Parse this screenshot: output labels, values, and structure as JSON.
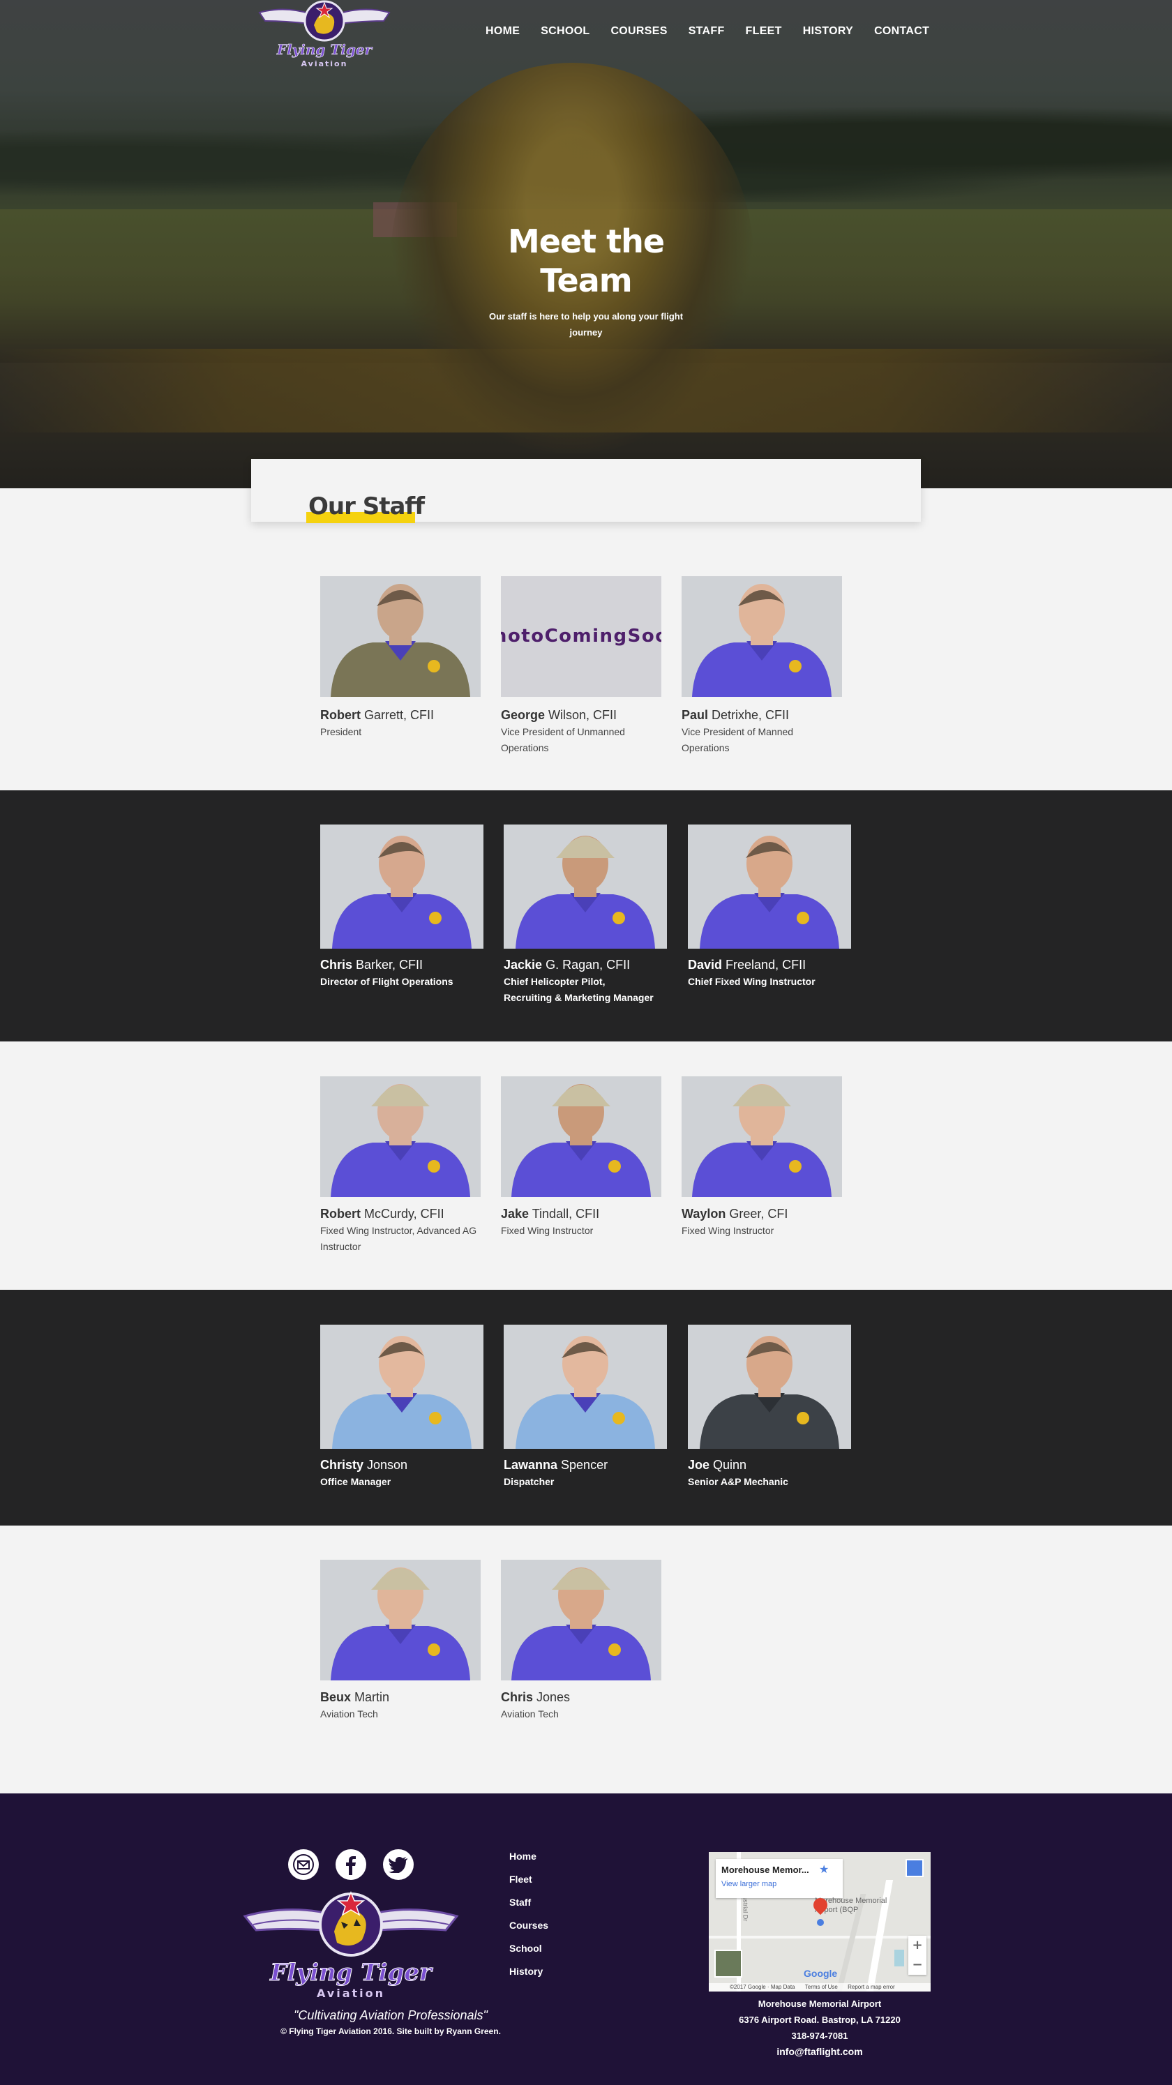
{
  "header": {
    "logo_alt": "Flying Tiger Aviation",
    "nav": [
      "HOME",
      "SCHOOL",
      "COURSES",
      "STAFF",
      "FLEET",
      "HISTORY",
      "CONTACT"
    ]
  },
  "hero": {
    "title_line1": "Meet the",
    "title_line2": "Team",
    "subtitle_line1": "Our staff is here to help you along your flight",
    "subtitle_line2": "journey"
  },
  "section_title": "Our Staff",
  "staff": [
    {
      "first": "Robert",
      "last": " Garrett, CFII",
      "role_lines": [
        "President"
      ]
    },
    {
      "first": "George",
      "last": " Wilson, CFII",
      "role_lines": [
        "Vice President of Unmanned",
        "Operations"
      ],
      "placeholder": [
        "Photo",
        "Coming",
        "Soon"
      ]
    },
    {
      "first": "Paul",
      "last": " Detrixhe, CFII",
      "role_lines": [
        "Vice President of Manned",
        "Operations"
      ]
    },
    {
      "first": "Chris",
      "last": " Barker, CFII",
      "role_lines": [
        "Director of Flight Operations"
      ]
    },
    {
      "first": "Jackie",
      "last": " G. Ragan, CFII",
      "role_lines": [
        "Chief Helicopter Pilot,",
        "Recruiting & Marketing Manager"
      ]
    },
    {
      "first": "David",
      "last": " Freeland, CFII",
      "role_lines": [
        "Chief Fixed Wing Instructor"
      ]
    },
    {
      "first": "Robert",
      "last": " McCurdy, CFII",
      "role_lines": [
        "Fixed Wing Instructor, Advanced AG",
        "Instructor"
      ]
    },
    {
      "first": "Jake",
      "last": " Tindall, CFII",
      "role_lines": [
        "Fixed Wing Instructor"
      ]
    },
    {
      "first": "Waylon",
      "last": " Greer, CFI",
      "role_lines": [
        "Fixed Wing Instructor"
      ]
    },
    {
      "first": "Christy",
      "last": " Jonson",
      "role_lines": [
        "Office Manager"
      ]
    },
    {
      "first": "Lawanna",
      "last": " Spencer",
      "role_lines": [
        "Dispatcher"
      ]
    },
    {
      "first": "Joe",
      "last": " Quinn",
      "role_lines": [
        "Senior A&P Mechanic"
      ]
    },
    {
      "first": "Beux",
      "last": " Martin",
      "role_lines": [
        "Aviation Tech"
      ]
    },
    {
      "first": "Chris",
      "last": " Jones",
      "role_lines": [
        "Aviation Tech"
      ]
    }
  ],
  "footer": {
    "links": [
      "Home",
      "Fleet",
      "Staff",
      "Courses",
      "School",
      "History"
    ],
    "logo_text": "Flying Tiger",
    "logo_sub": "Aviation",
    "motto": "\"Cultivating Aviation Professionals\"",
    "copyright_prefix": "© Flying Tiger Aviation 2016. Site built by ",
    "copyright_author": "Ryann Green.",
    "map": {
      "place": "Morehouse Memor...",
      "view_larger": "View larger map",
      "pin_label_1": "Morehouse Memorial",
      "pin_label_2": "Airport (BQP",
      "attribution": "©2017 Google · Map Data",
      "terms": "Terms of Use",
      "report": "Report a map error",
      "google": "Google",
      "road": "Industrial Dr",
      "zoom_in": "+",
      "zoom_out": "−"
    },
    "address_name": "Morehouse Memorial Airport",
    "address_street": "6376 Airport Road. Bastrop, LA 71220",
    "phone": "318-974-7081",
    "email": "info@ftaflight.com"
  },
  "colors": {
    "brand_purple": "#1f1237",
    "highlight_yellow": "#f5d20f",
    "dark_band": "#242425",
    "light_band": "#f3f3f3",
    "shirt_purple": "#5b4fd6"
  }
}
